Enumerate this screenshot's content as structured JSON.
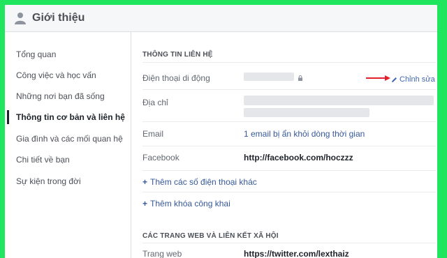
{
  "header": {
    "title": "Giới thiệu"
  },
  "sidebar": {
    "items": [
      {
        "label": "Tổng quan"
      },
      {
        "label": "Công việc và học vấn"
      },
      {
        "label": "Những nơi bạn đã sống"
      },
      {
        "label": "Thông tin cơ bản và liên hệ",
        "active": true
      },
      {
        "label": "Gia đình và các mối quan hệ"
      },
      {
        "label": "Chi tiết về bạn"
      },
      {
        "label": "Sự kiện trong đời"
      }
    ]
  },
  "contact": {
    "section_title": "THÔNG TIN LIÊN HỆ",
    "phone_label": "Điện thoại di động",
    "edit_label": "Chỉnh sửa",
    "address_label": "Địa chỉ",
    "email_label": "Email",
    "email_value": "1 email bị ẩn khỏi dòng thời gian",
    "facebook_label": "Facebook",
    "facebook_value": "http://facebook.com/hoczzz",
    "add_phone": "Thêm các số điện thoại khác",
    "add_key": "Thêm khóa công khai"
  },
  "web": {
    "section_title": "CÁC TRANG WEB VÀ LIÊN KẾT XÃ HỘI",
    "website_label": "Trang web",
    "website_value": "https://twitter.com/lexthaiz"
  },
  "colors": {
    "background": "#1fe55f",
    "link": "#365899",
    "arrow": "#e0202a"
  }
}
